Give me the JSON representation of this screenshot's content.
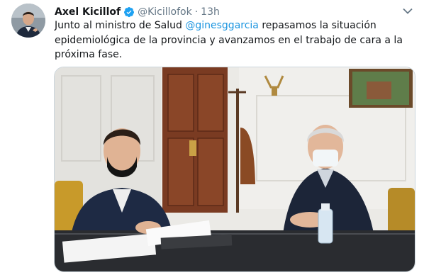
{
  "tweet": {
    "author_name": "Axel Kicillof",
    "handle": "@Kicillofok",
    "separator": "·",
    "time": "13h",
    "text": {
      "line1_before": "Junto al ministro de Salud ",
      "mention": "@ginesggarcia",
      "line1_after": " repasamos la situación",
      "line2": "epidemiológica de la provincia y avanzamos en el trabajo de cara a la",
      "line3": "próxima fase."
    }
  },
  "icons": {
    "verified": "verified-badge-icon",
    "more": "chevron-down-icon"
  },
  "colors": {
    "link": "#1b95e0",
    "verified": "#1da1f2",
    "secondary_text": "#657786"
  }
}
